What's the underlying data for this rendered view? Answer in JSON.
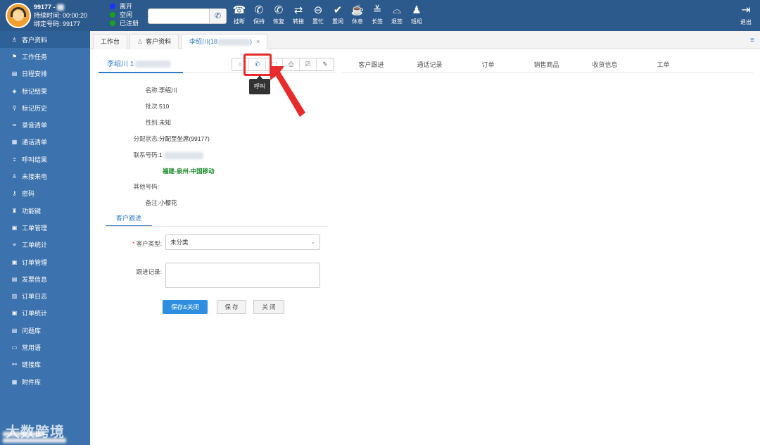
{
  "topbar": {
    "agent_name": "99177 - ",
    "duration_label": "持续时间:",
    "duration_value": "00:00:20",
    "bound_label": "绑定号码:",
    "bound_value": "99177",
    "statuses": [
      {
        "label": "离开",
        "color": "#1a33ff"
      },
      {
        "label": "空闲",
        "color": "#1aa01a"
      },
      {
        "label": "已注册",
        "color": "#1aa01a"
      }
    ],
    "dial_placeholder": "",
    "tools": [
      {
        "label": "挂断",
        "icon": "hangup-icon",
        "glyph": "☎"
      },
      {
        "label": "保持",
        "icon": "hold-icon",
        "glyph": "✆"
      },
      {
        "label": "恢复",
        "icon": "resume-icon",
        "glyph": "✆"
      },
      {
        "label": "转接",
        "icon": "transfer-icon",
        "glyph": "⇄"
      },
      {
        "label": "置忙",
        "icon": "busy-icon",
        "glyph": "⊖"
      },
      {
        "label": "置闲",
        "icon": "idle-icon",
        "glyph": "✔"
      },
      {
        "label": "休息",
        "icon": "rest-icon",
        "glyph": "☕"
      },
      {
        "label": "长签",
        "icon": "long-sign-icon",
        "glyph": "≚"
      },
      {
        "label": "退签",
        "icon": "sign-out-icon",
        "glyph": "⌓"
      },
      {
        "label": "班组",
        "icon": "team-icon",
        "glyph": "♟"
      }
    ],
    "logout_label": "退出"
  },
  "sidebar": {
    "items": [
      {
        "label": "客户资料",
        "icon": "customer-icon",
        "glyph": "♙",
        "active": true
      },
      {
        "label": "工作任务",
        "icon": "task-icon",
        "glyph": "⚑"
      },
      {
        "label": "日程安排",
        "icon": "calendar-icon",
        "glyph": "▤"
      },
      {
        "label": "标记结果",
        "icon": "tag-icon",
        "glyph": "◈"
      },
      {
        "label": "标记历史",
        "icon": "history-icon",
        "glyph": "⚲"
      },
      {
        "label": "录音清单",
        "icon": "recording-icon",
        "glyph": "∞"
      },
      {
        "label": "通话清单",
        "icon": "call-list-icon",
        "glyph": "▦"
      },
      {
        "label": "呼叫结果",
        "icon": "call-result-icon",
        "glyph": "≑"
      },
      {
        "label": "未接来电",
        "icon": "missed-call-icon",
        "glyph": "♙"
      },
      {
        "label": "密码",
        "icon": "key-icon",
        "glyph": "⚷"
      },
      {
        "label": "功能键",
        "icon": "function-key-icon",
        "glyph": "♜"
      },
      {
        "label": "工单管理",
        "icon": "workorder-icon",
        "glyph": "▣"
      },
      {
        "label": "工单统计",
        "icon": "stats-icon",
        "glyph": "≡"
      },
      {
        "label": "订单管理",
        "icon": "order-icon",
        "glyph": "▣"
      },
      {
        "label": "发票信息",
        "icon": "invoice-icon",
        "glyph": "▤"
      },
      {
        "label": "订单日志",
        "icon": "order-log-icon",
        "glyph": "▥"
      },
      {
        "label": "订单统计",
        "icon": "order-stats-icon",
        "glyph": "▣"
      },
      {
        "label": "问题库",
        "icon": "question-icon",
        "glyph": "▤"
      },
      {
        "label": "常用语",
        "icon": "phrases-icon",
        "glyph": "▭"
      },
      {
        "label": "链接库",
        "icon": "link-icon",
        "glyph": "⚯"
      },
      {
        "label": "附件库",
        "icon": "attachment-icon",
        "glyph": "▦"
      }
    ],
    "watermark": "大数跨境"
  },
  "tabs": [
    {
      "label": "工作台"
    },
    {
      "label": "客户资料"
    },
    {
      "label": "李绍川(18",
      "closable": true,
      "active": true
    }
  ],
  "customer": {
    "tab_label": "李绍川 1",
    "fields": [
      {
        "label": "名称:",
        "value": "李绍川"
      },
      {
        "label": "批次:",
        "value": "510"
      },
      {
        "label": "性别:",
        "value": "未知"
      },
      {
        "label": "分配状态:",
        "value": "分配至坐席(99177)"
      },
      {
        "label": "联系号码:",
        "value": "1"
      },
      {
        "label": "其他号码:",
        "value": ""
      },
      {
        "label": "备注:",
        "value": "小樱花"
      }
    ],
    "location": "福建-泉州-中国移动"
  },
  "actions": [
    {
      "name": "search-action",
      "glyph": "○"
    },
    {
      "name": "call-action",
      "glyph": "✆"
    },
    {
      "name": "chat-action",
      "glyph": "⬚"
    },
    {
      "name": "save-action",
      "glyph": "⎙"
    },
    {
      "name": "print-action",
      "glyph": "⎚"
    },
    {
      "name": "edit-action",
      "glyph": "✎"
    }
  ],
  "tooltip": "呼叫",
  "follow": {
    "tab_label": "客户跟进",
    "type_label": "客户类型:",
    "type_value": "未分类",
    "record_label": "跟进记录:",
    "save_close": "保存&关闭",
    "save": "保 存",
    "close": "关 闭"
  },
  "right_tabs": [
    "客户跟进",
    "通话记录",
    "订单",
    "销售商品",
    "收货信息",
    "工单"
  ],
  "colors": {
    "accent": "#2f78c6",
    "sidebar": "#3c72ad",
    "topbar": "#2d5a8c",
    "highlight": "#e82b2b"
  }
}
